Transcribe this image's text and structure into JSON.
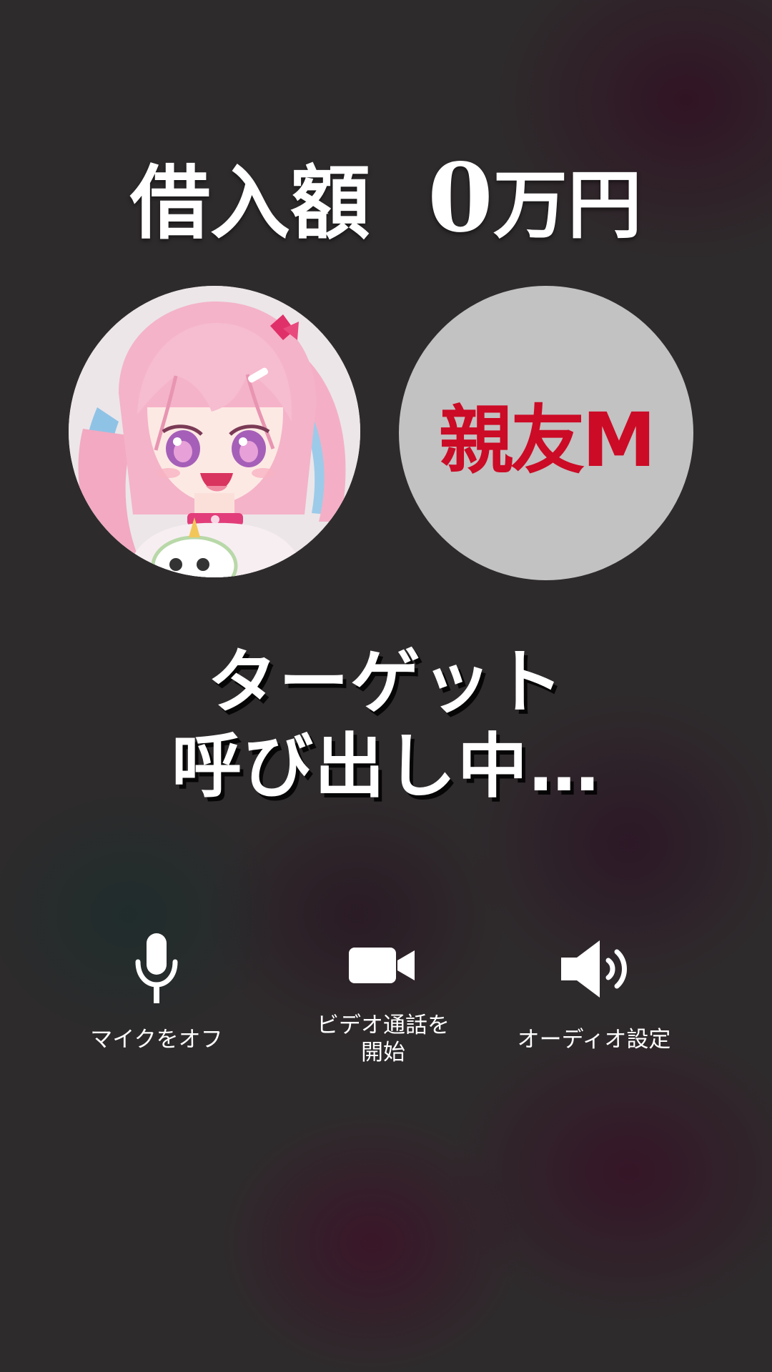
{
  "headline": {
    "label": "借入額",
    "amount": "0",
    "unit": "万円"
  },
  "avatars": {
    "left": {
      "icon": "anime-girl-avatar"
    },
    "right": {
      "name": "親友M",
      "text_color": "#cc0b26",
      "background": "#c2c2c2"
    }
  },
  "status": {
    "line1": "ターゲット",
    "line2": "呼び出し中…"
  },
  "controls": {
    "mic": {
      "label": "マイクをオフ",
      "icon": "microphone-icon"
    },
    "video": {
      "label_line1": "ビデオ通話を",
      "label_line2": "開始",
      "icon": "video-camera-icon"
    },
    "audio": {
      "label": "オーディオ設定",
      "icon": "speaker-icon"
    }
  }
}
